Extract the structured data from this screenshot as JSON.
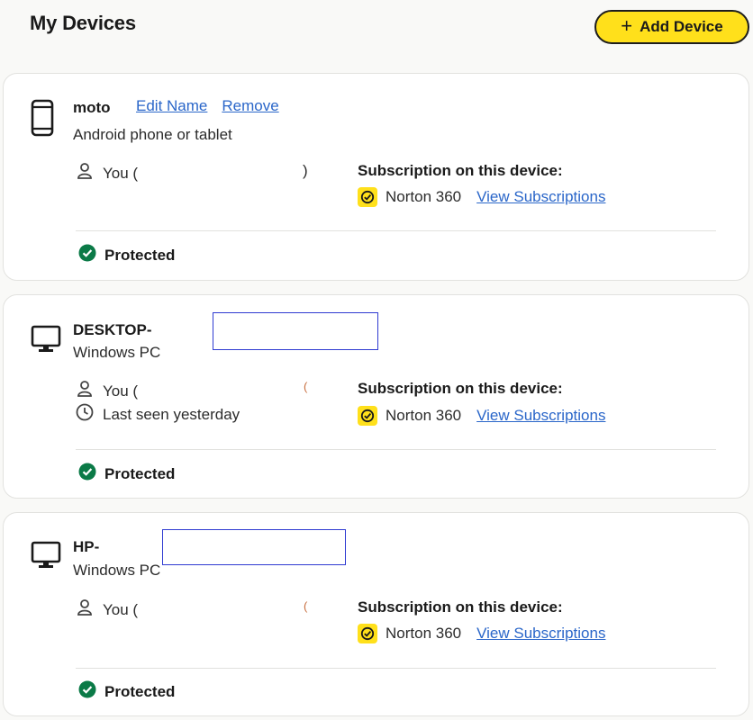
{
  "header": {
    "title": "My Devices",
    "add_device_label": "Add Device",
    "add_device_icon": "plus-icon"
  },
  "colors": {
    "brand_yellow": "#ffe01b",
    "link_blue": "#2a66c9",
    "protected_green": "#0b7a47"
  },
  "devices": [
    {
      "name": "moto",
      "icon": "phone-icon",
      "type": "Android phone or tablet",
      "edit_name_label": "Edit Name",
      "remove_label": "Remove",
      "owner_prefix": "You (",
      "owner_suffix": ")",
      "last_seen": "",
      "subscription_title": "Subscription on this device:",
      "subscription_name": "Norton 360",
      "view_subscriptions_label": "View Subscriptions",
      "status": "Protected"
    },
    {
      "name": "DESKTOP-",
      "icon": "desktop-monitor-icon",
      "type": "Windows PC",
      "owner_prefix": "You (",
      "owner_suffix": "(",
      "last_seen": "Last seen yesterday",
      "subscription_title": "Subscription on this device:",
      "subscription_name": "Norton 360",
      "view_subscriptions_label": "View Subscriptions",
      "status": "Protected"
    },
    {
      "name": "HP-",
      "icon": "desktop-monitor-icon",
      "type": "Windows PC",
      "owner_prefix": "You (",
      "owner_suffix": "(",
      "last_seen": "",
      "subscription_title": "Subscription on this device:",
      "subscription_name": "Norton 360",
      "view_subscriptions_label": "View Subscriptions",
      "status": "Protected"
    }
  ]
}
